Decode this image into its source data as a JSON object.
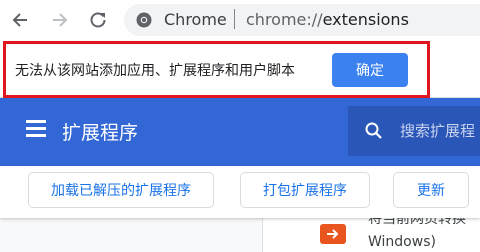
{
  "browser": {
    "omnibox_chip": "Chrome",
    "url_scheme": "chrome://",
    "url_path": "extensions"
  },
  "infobar": {
    "message": "无法从该网站添加应用、扩展程序和用户脚本",
    "confirm_label": "确定",
    "highlight_color": "#e0161e"
  },
  "extensions_page": {
    "title": "扩展程序",
    "search_placeholder": "搜索扩展程",
    "actions": [
      {
        "label": "加载已解压的扩展程序"
      },
      {
        "label": "打包扩展程序"
      },
      {
        "label": "更新"
      }
    ],
    "card_text_line1": "将当前网页转换",
    "card_text_line2": "Windows)"
  },
  "colors": {
    "header_blue": "#3367d6",
    "button_blue": "#3b82f0",
    "link_blue": "#1a73e8"
  }
}
